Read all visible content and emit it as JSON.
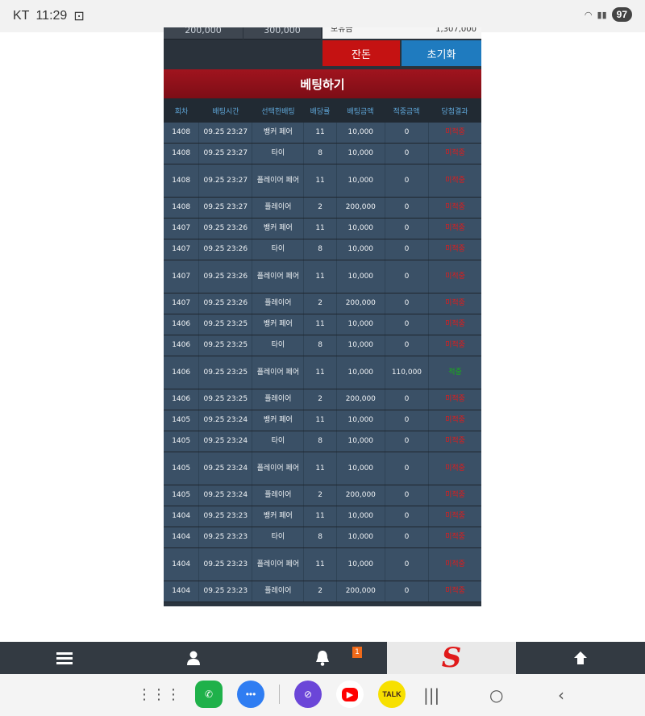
{
  "status": {
    "carrier": "KT",
    "time": "11:29",
    "battery": "97"
  },
  "balances": {
    "b1": "200,000",
    "b2": "300,000",
    "white_left": "보유금",
    "white_right": "1,307,000"
  },
  "buttons": {
    "balance": "잔돈",
    "reset": "초기화"
  },
  "title": "베팅하기",
  "columns": [
    "회차",
    "배팅시간",
    "선택한배팅",
    "배당률",
    "배팅금액",
    "적중금액",
    "당첨결과"
  ],
  "rows": [
    {
      "round": "1408",
      "time": "09.25 23:27",
      "pick": "뱅커 페어",
      "odds": "11",
      "amount": "10,000",
      "win": "0",
      "result": "미적중",
      "hit": false
    },
    {
      "round": "1408",
      "time": "09.25 23:27",
      "pick": "타이",
      "odds": "8",
      "amount": "10,000",
      "win": "0",
      "result": "미적중",
      "hit": false
    },
    {
      "round": "1408",
      "time": "09.25 23:27",
      "pick": "플레이어 페어",
      "odds": "11",
      "amount": "10,000",
      "win": "0",
      "result": "미적중",
      "hit": false,
      "tall": true
    },
    {
      "round": "1408",
      "time": "09.25 23:27",
      "pick": "플레이어",
      "odds": "2",
      "amount": "200,000",
      "win": "0",
      "result": "미적중",
      "hit": false
    },
    {
      "round": "1407",
      "time": "09.25 23:26",
      "pick": "뱅커 페어",
      "odds": "11",
      "amount": "10,000",
      "win": "0",
      "result": "미적중",
      "hit": false
    },
    {
      "round": "1407",
      "time": "09.25 23:26",
      "pick": "타이",
      "odds": "8",
      "amount": "10,000",
      "win": "0",
      "result": "미적중",
      "hit": false
    },
    {
      "round": "1407",
      "time": "09.25 23:26",
      "pick": "플레이어 페어",
      "odds": "11",
      "amount": "10,000",
      "win": "0",
      "result": "미적중",
      "hit": false,
      "tall": true
    },
    {
      "round": "1407",
      "time": "09.25 23:26",
      "pick": "플레이어",
      "odds": "2",
      "amount": "200,000",
      "win": "0",
      "result": "미적중",
      "hit": false
    },
    {
      "round": "1406",
      "time": "09.25 23:25",
      "pick": "뱅커 페어",
      "odds": "11",
      "amount": "10,000",
      "win": "0",
      "result": "미적중",
      "hit": false
    },
    {
      "round": "1406",
      "time": "09.25 23:25",
      "pick": "타이",
      "odds": "8",
      "amount": "10,000",
      "win": "0",
      "result": "미적중",
      "hit": false
    },
    {
      "round": "1406",
      "time": "09.25 23:25",
      "pick": "플레이어 페어",
      "odds": "11",
      "amount": "10,000",
      "win": "110,000",
      "result": "적중",
      "hit": true,
      "tall": true
    },
    {
      "round": "1406",
      "time": "09.25 23:25",
      "pick": "플레이어",
      "odds": "2",
      "amount": "200,000",
      "win": "0",
      "result": "미적중",
      "hit": false
    },
    {
      "round": "1405",
      "time": "09.25 23:24",
      "pick": "뱅커 페어",
      "odds": "11",
      "amount": "10,000",
      "win": "0",
      "result": "미적중",
      "hit": false
    },
    {
      "round": "1405",
      "time": "09.25 23:24",
      "pick": "타이",
      "odds": "8",
      "amount": "10,000",
      "win": "0",
      "result": "미적중",
      "hit": false
    },
    {
      "round": "1405",
      "time": "09.25 23:24",
      "pick": "플레이어 페어",
      "odds": "11",
      "amount": "10,000",
      "win": "0",
      "result": "미적중",
      "hit": false,
      "tall": true
    },
    {
      "round": "1405",
      "time": "09.25 23:24",
      "pick": "플레이어",
      "odds": "2",
      "amount": "200,000",
      "win": "0",
      "result": "미적중",
      "hit": false
    },
    {
      "round": "1404",
      "time": "09.25 23:23",
      "pick": "뱅커 페어",
      "odds": "11",
      "amount": "10,000",
      "win": "0",
      "result": "미적중",
      "hit": false
    },
    {
      "round": "1404",
      "time": "09.25 23:23",
      "pick": "타이",
      "odds": "8",
      "amount": "10,000",
      "win": "0",
      "result": "미적중",
      "hit": false
    },
    {
      "round": "1404",
      "time": "09.25 23:23",
      "pick": "플레이어 페어",
      "odds": "11",
      "amount": "10,000",
      "win": "0",
      "result": "미적중",
      "hit": false,
      "tall": true
    },
    {
      "round": "1404",
      "time": "09.25 23:23",
      "pick": "플레이어",
      "odds": "2",
      "amount": "200,000",
      "win": "0",
      "result": "미적중",
      "hit": false
    }
  ],
  "appnav": {
    "notification_count": "1",
    "logo": "S"
  },
  "icons": {
    "menu": "hamburger-icon",
    "user": "user-icon",
    "bell": "bell-icon",
    "up": "arrow-up-icon"
  },
  "dock": {
    "talk_label": "TALK"
  },
  "colors": {
    "title": "#8e111b",
    "miss": "#e21b1b",
    "hit": "#18b018",
    "reset": "#1f7bbf",
    "balance": "#c51212"
  }
}
